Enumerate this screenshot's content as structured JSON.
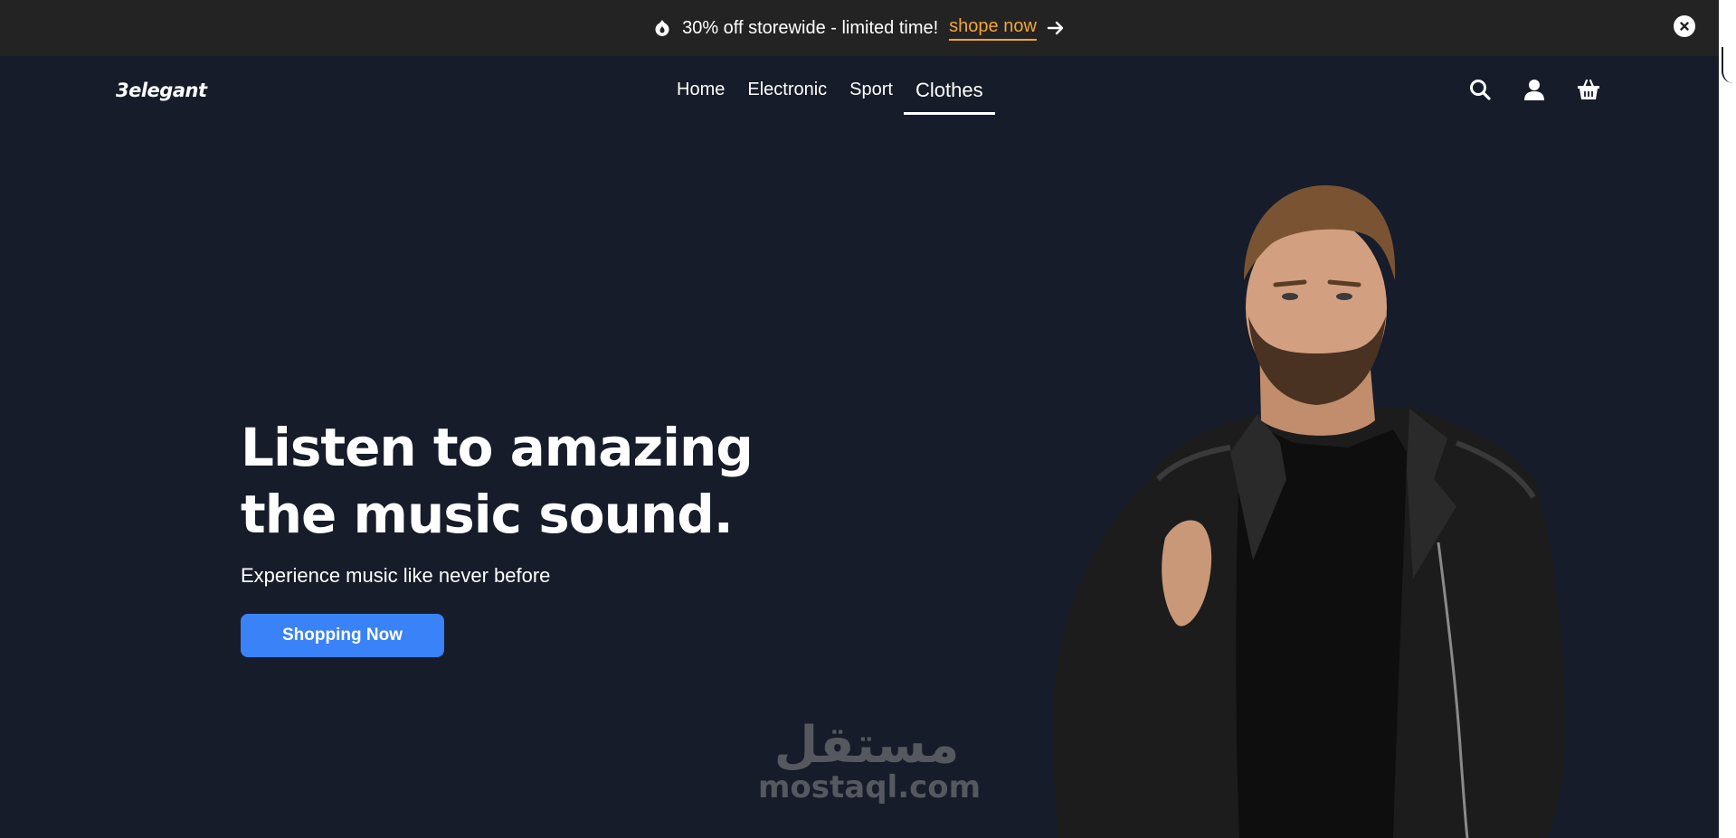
{
  "promo": {
    "text": "30% off storewide - limited time!",
    "link_label": "shope now",
    "fire_icon": "fire-icon",
    "arrow_icon": "arrow-right-icon",
    "close_icon": "close-icon",
    "link_color": "#f2a636"
  },
  "navbar": {
    "logo": "3elegant",
    "links": [
      {
        "label": "Home",
        "active": false
      },
      {
        "label": "Electronic",
        "active": false
      },
      {
        "label": "Sport",
        "active": false
      },
      {
        "label": "Clothes",
        "active": true
      }
    ],
    "icons": [
      "search-icon",
      "user-icon",
      "basket-icon"
    ]
  },
  "hero": {
    "title_line1": "Listen to amazing",
    "title_line2": "the music sound.",
    "subtitle": "Experience music like never before",
    "button_label": "Shopping Now",
    "button_color": "#3a82f7",
    "image": "man in black leather jacket"
  },
  "watermark": {
    "arabic": "مستقل",
    "latin": "mostaql.com"
  },
  "colors": {
    "background": "#161c29",
    "promo_bar": "#232323"
  }
}
